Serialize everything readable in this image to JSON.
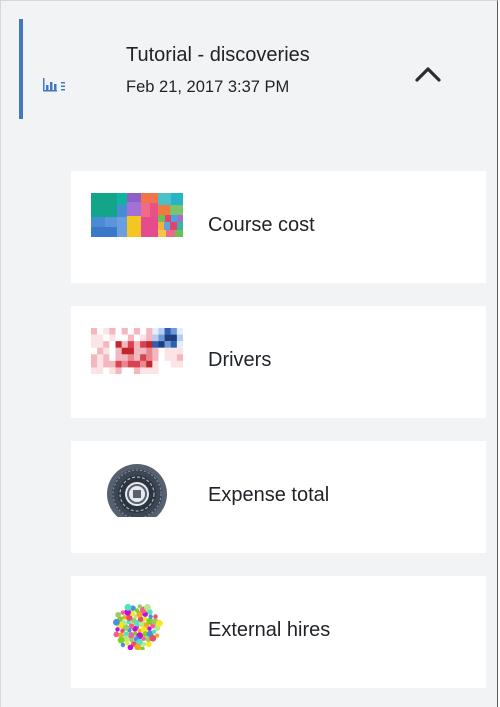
{
  "colors": {
    "accent": "#4178be",
    "panel_bg": "#f2f3f5",
    "card_bg": "#ffffff"
  },
  "header": {
    "title": "Tutorial - discoveries",
    "date": "Feb 21, 2017 3:37 PM",
    "icon": "bar-chart-list-icon",
    "collapse_icon": "chevron-up-icon"
  },
  "cards": [
    {
      "label": "Course cost",
      "thumbnail": "treemap-thumbnail"
    },
    {
      "label": "Drivers",
      "thumbnail": "heatmap-thumbnail"
    },
    {
      "label": "Expense total",
      "thumbnail": "radial-chart-thumbnail"
    },
    {
      "label": "External hires",
      "thumbnail": "bubble-cluster-thumbnail"
    }
  ]
}
